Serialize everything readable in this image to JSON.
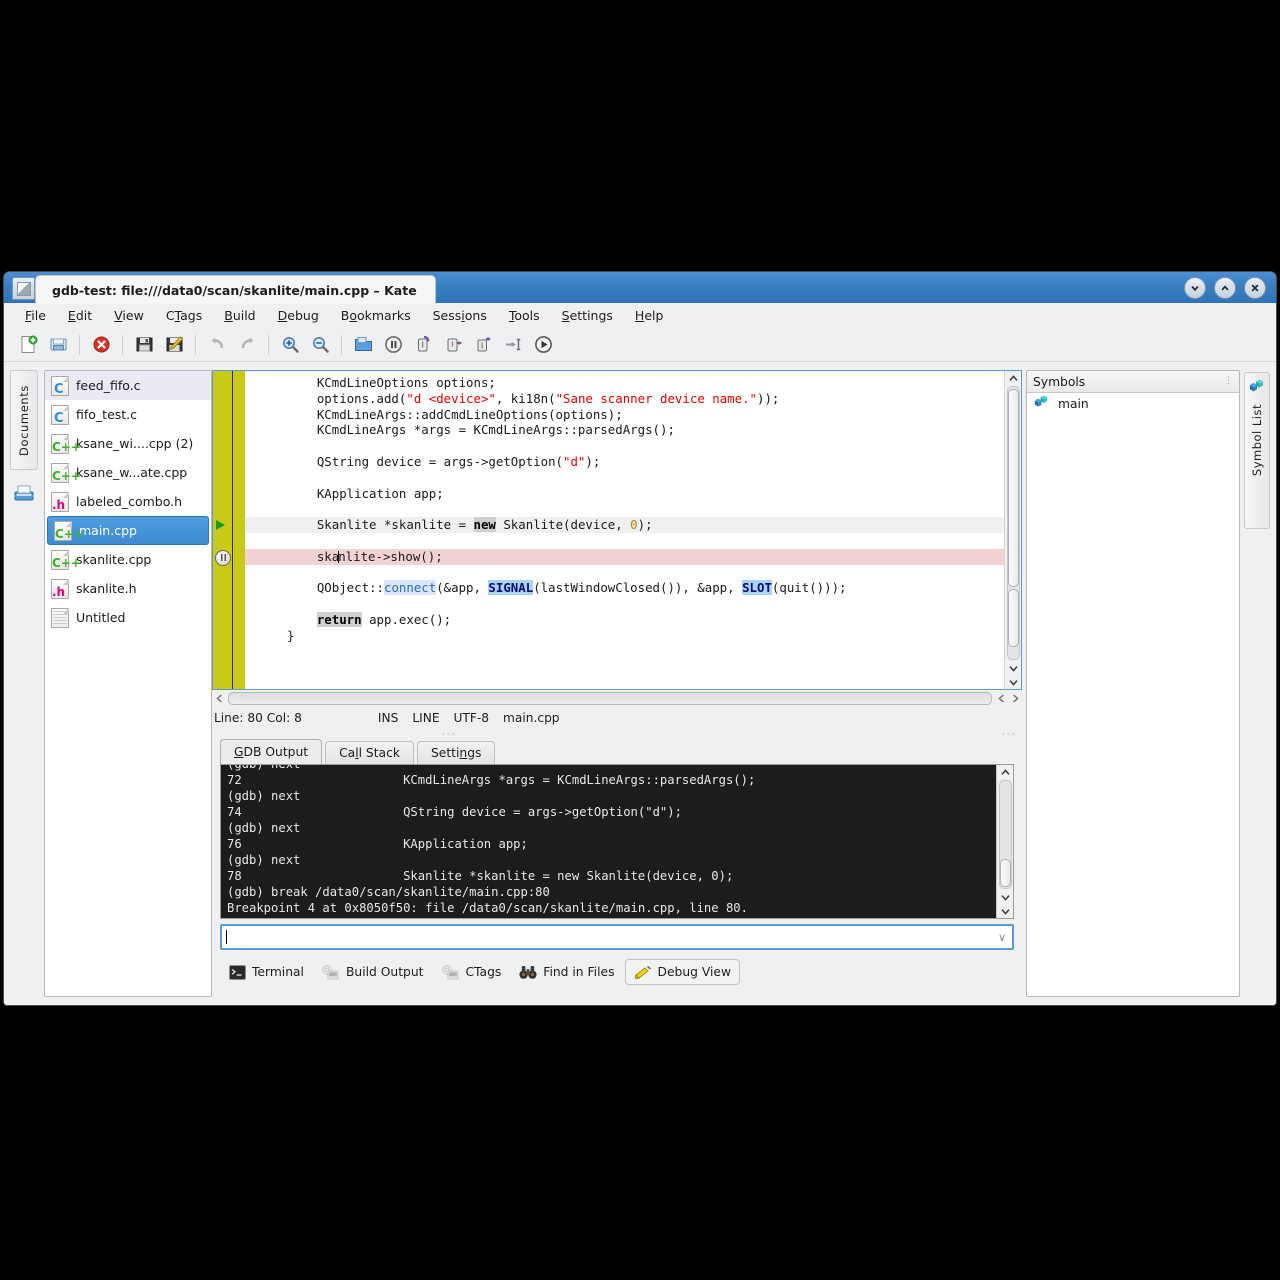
{
  "window": {
    "title": "gdb-test: file:///data0/scan/skanlite/main.cpp – Kate",
    "app_icon": "kate-icon",
    "buttons": [
      {
        "name": "minimize-button",
        "glyph": "chevron-down-icon"
      },
      {
        "name": "maximize-button",
        "glyph": "chevron-up-icon"
      },
      {
        "name": "close-button",
        "glyph": "close-icon"
      }
    ]
  },
  "menubar": {
    "items": [
      {
        "label": "File",
        "accel": "F"
      },
      {
        "label": "Edit",
        "accel": "E"
      },
      {
        "label": "View",
        "accel": "V"
      },
      {
        "label": "CTags",
        "accel": "T"
      },
      {
        "label": "Build",
        "accel": "B"
      },
      {
        "label": "Debug",
        "accel": "D"
      },
      {
        "label": "Bookmarks",
        "accel": "o"
      },
      {
        "label": "Sessions",
        "accel": "i"
      },
      {
        "label": "Tools",
        "accel": "T"
      },
      {
        "label": "Settings",
        "accel": "S"
      },
      {
        "label": "Help",
        "accel": "H"
      }
    ]
  },
  "toolbar": {
    "buttons": [
      {
        "name": "new-file-button",
        "icon": "new-document-icon"
      },
      {
        "name": "open-file-button",
        "icon": "open-folder-icon"
      },
      {
        "name": "close-document-button",
        "icon": "close-red-x-icon"
      },
      {
        "name": "save-button",
        "icon": "floppy-save-icon"
      },
      {
        "name": "save-as-button",
        "icon": "save-as-icon"
      },
      {
        "name": "undo-button",
        "icon": "undo-arrow-icon"
      },
      {
        "name": "redo-button",
        "icon": "redo-arrow-icon"
      },
      {
        "name": "zoom-in-button",
        "icon": "magnifier-plus-icon"
      },
      {
        "name": "zoom-out-button",
        "icon": "magnifier-minus-icon"
      },
      {
        "name": "open-project-button",
        "icon": "blue-folder-icon"
      },
      {
        "name": "pause-debug-button",
        "icon": "pause-circle-icon"
      },
      {
        "name": "step-over-button",
        "icon": "step-over-icon"
      },
      {
        "name": "step-into-button",
        "icon": "step-into-icon"
      },
      {
        "name": "step-out-button",
        "icon": "step-out-icon"
      },
      {
        "name": "run-to-cursor-button",
        "icon": "run-to-cursor-icon"
      },
      {
        "name": "continue-button",
        "icon": "play-circle-icon"
      }
    ]
  },
  "left_sidebar": {
    "tab_label": "Documents",
    "filesystem_icon": "filesystem-browser-icon"
  },
  "documents": [
    {
      "name": "feed_fifo.c",
      "kind": "c",
      "selected": false,
      "highlighted": true
    },
    {
      "name": "fifo_test.c",
      "kind": "c",
      "selected": false,
      "highlighted": false
    },
    {
      "name": "ksane_wi....cpp (2)",
      "kind": "cpp",
      "selected": false,
      "highlighted": false
    },
    {
      "name": "ksane_w...ate.cpp",
      "kind": "cpp",
      "selected": false,
      "highlighted": false
    },
    {
      "name": "labeled_combo.h",
      "kind": "h",
      "selected": false,
      "highlighted": false
    },
    {
      "name": "main.cpp",
      "kind": "cpp",
      "selected": true,
      "highlighted": false
    },
    {
      "name": "skanlite.cpp",
      "kind": "cpp",
      "selected": false,
      "highlighted": false
    },
    {
      "name": "skanlite.h",
      "kind": "h",
      "selected": false,
      "highlighted": false
    },
    {
      "name": "Untitled",
      "kind": "plain",
      "selected": false,
      "highlighted": false
    }
  ],
  "editor": {
    "lines": [
      {
        "state": "normal",
        "marker": "none",
        "parts": [
          {
            "t": "    KCmdLineOptions options;",
            "c": "plain"
          }
        ]
      },
      {
        "state": "normal",
        "marker": "none",
        "parts": [
          {
            "t": "    options.add(",
            "c": "plain"
          },
          {
            "t": "\"d <device>\"",
            "c": "str"
          },
          {
            "t": ", ki18n(",
            "c": "plain"
          },
          {
            "t": "\"Sane scanner device name.\"",
            "c": "str"
          },
          {
            "t": "));",
            "c": "plain"
          }
        ]
      },
      {
        "state": "normal",
        "marker": "none",
        "parts": [
          {
            "t": "    KCmdLineArgs::addCmdLineOptions(options);",
            "c": "plain"
          }
        ]
      },
      {
        "state": "normal",
        "marker": "none",
        "parts": [
          {
            "t": "    KCmdLineArgs *args = KCmdLineArgs::parsedArgs();",
            "c": "plain"
          }
        ]
      },
      {
        "state": "normal",
        "marker": "none",
        "parts": [
          {
            "t": "",
            "c": "plain"
          }
        ]
      },
      {
        "state": "normal",
        "marker": "none",
        "parts": [
          {
            "t": "    QString device = args->getOption(",
            "c": "plain"
          },
          {
            "t": "\"d\"",
            "c": "str"
          },
          {
            "t": ");",
            "c": "plain"
          }
        ]
      },
      {
        "state": "normal",
        "marker": "none",
        "parts": [
          {
            "t": "",
            "c": "plain"
          }
        ]
      },
      {
        "state": "normal",
        "marker": "none",
        "parts": [
          {
            "t": "    KApplication app;",
            "c": "plain"
          }
        ]
      },
      {
        "state": "normal",
        "marker": "none",
        "parts": [
          {
            "t": "",
            "c": "plain"
          }
        ]
      },
      {
        "state": "current",
        "marker": "exec",
        "parts": [
          {
            "t": "    Skanlite *skanlite = ",
            "c": "plain"
          },
          {
            "t": "new",
            "c": "kw"
          },
          {
            "t": " Skanlite(device, ",
            "c": "plain"
          },
          {
            "t": "0",
            "c": "num"
          },
          {
            "t": ");",
            "c": "plain"
          }
        ]
      },
      {
        "state": "normal",
        "marker": "none",
        "parts": [
          {
            "t": "",
            "c": "plain"
          }
        ]
      },
      {
        "state": "break",
        "marker": "breakpoint",
        "parts": [
          {
            "t": "    ska",
            "c": "plain"
          },
          {
            "t": "",
            "c": "caret"
          },
          {
            "t": "nlite->show();",
            "c": "plain"
          }
        ]
      },
      {
        "state": "normal",
        "marker": "none",
        "parts": [
          {
            "t": "",
            "c": "plain"
          }
        ]
      },
      {
        "state": "normal",
        "marker": "none",
        "parts": [
          {
            "t": "    QObject::",
            "c": "plain"
          },
          {
            "t": "connect",
            "c": "fn"
          },
          {
            "t": "(&app, ",
            "c": "plain"
          },
          {
            "t": "SIGNAL",
            "c": "macro"
          },
          {
            "t": "(lastWindowClosed()), &app, ",
            "c": "plain"
          },
          {
            "t": "SLOT",
            "c": "macro"
          },
          {
            "t": "(quit()));",
            "c": "plain"
          }
        ]
      },
      {
        "state": "normal",
        "marker": "none",
        "parts": [
          {
            "t": "",
            "c": "plain"
          }
        ]
      },
      {
        "state": "normal",
        "marker": "none",
        "parts": [
          {
            "t": "    ",
            "c": "plain"
          },
          {
            "t": "return",
            "c": "kw"
          },
          {
            "t": " app.exec();",
            "c": "plain"
          }
        ]
      },
      {
        "state": "normal",
        "marker": "none",
        "parts": [
          {
            "t": "}",
            "c": "plain"
          }
        ]
      }
    ]
  },
  "statusbar": {
    "position": "Line: 80 Col: 8",
    "insert_mode": "INS",
    "selection_mode": "LINE",
    "encoding": "UTF-8",
    "filename": "main.cpp"
  },
  "debug_tabs": [
    {
      "label": "GDB Output",
      "accel": "G",
      "active": true
    },
    {
      "label": "Call Stack",
      "accel": "l",
      "active": false
    },
    {
      "label": "Settings",
      "accel": "n",
      "active": false
    }
  ],
  "gdb_output": {
    "lines": [
      "(gdb) next",
      "72                      KCmdLineArgs *args = KCmdLineArgs::parsedArgs();",
      "(gdb) next",
      "74                      QString device = args->getOption(\"d\");",
      "(gdb) next",
      "76                      KApplication app;",
      "(gdb) next",
      "78                      Skanlite *skanlite = new Skanlite(device, 0);",
      "(gdb) break /data0/scan/skanlite/main.cpp:80",
      "Breakpoint 4 at 0x8050f50: file /data0/scan/skanlite/main.cpp, line 80."
    ]
  },
  "gdb_input": {
    "value": "",
    "placeholder": "",
    "dropdown_icon": "chevron-down-icon"
  },
  "bottom_tools": [
    {
      "label": "Terminal",
      "icon": "terminal-icon",
      "active": false,
      "dim": false
    },
    {
      "label": "Build Output",
      "icon": "build-output-icon",
      "active": false,
      "dim": true
    },
    {
      "label": "CTags",
      "icon": "ctags-icon",
      "active": false,
      "dim": true
    },
    {
      "label": "Find in Files",
      "icon": "binoculars-icon",
      "active": false,
      "dim": false
    },
    {
      "label": "Debug View",
      "icon": "debug-broom-icon",
      "active": true,
      "dim": false
    }
  ],
  "symbols_panel": {
    "header": "Symbols",
    "vertical_tab": "Symbol List",
    "items": [
      {
        "label": "main",
        "icon": "symbol-cubes-icon"
      }
    ]
  },
  "colors": {
    "titlebar": "#3a7fc4",
    "window_bg": "#eff0f1",
    "icon_border": "#c9ca18",
    "selection_blue": "#3d8ad0",
    "breakpoint_line": "#f2d3d3",
    "current_line": "#f0f0f0",
    "string_red": "#e00000",
    "console_bg": "#1c1c1c",
    "focus_border": "#5b9bd5"
  }
}
